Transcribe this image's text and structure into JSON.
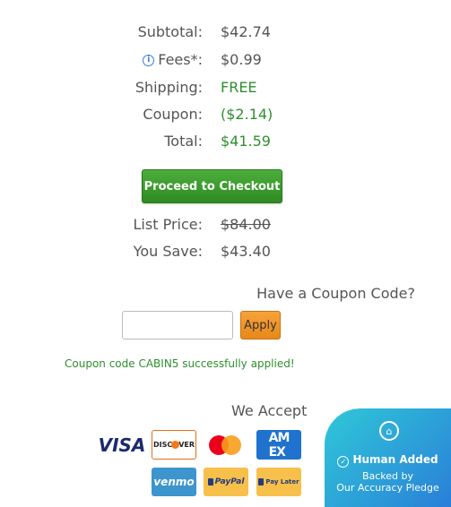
{
  "summary": {
    "subtotal": {
      "label": "Subtotal:",
      "value": "$42.74"
    },
    "fees": {
      "label": "Fees*:",
      "value": "$0.99",
      "icon": "info-icon"
    },
    "shipping": {
      "label": "Shipping:",
      "value": "FREE"
    },
    "coupon": {
      "label": "Coupon:",
      "value": "($2.14)"
    },
    "total": {
      "label": "Total:",
      "value": "$41.59"
    }
  },
  "checkout": {
    "button_label": "Proceed to Checkout"
  },
  "savings": {
    "list_price": {
      "label": "List Price:",
      "value": "$84.00"
    },
    "you_save": {
      "label": "You Save:",
      "value": "$43.40"
    }
  },
  "coupon_code": {
    "title": "Have a Coupon Code?",
    "input_value": "",
    "input_placeholder": "",
    "apply_label": "Apply",
    "success_message": "Coupon code CABIN5 successfully applied!"
  },
  "payments": {
    "title": "We Accept",
    "methods": [
      "VISA",
      "DISCOVER",
      "Mastercard",
      "AMEX",
      "venmo",
      "PayPal",
      "Pay Later"
    ]
  },
  "badge": {
    "title": "Human Added",
    "line1": "Backed by",
    "line2": "Our Accuracy Pledge"
  },
  "colors": {
    "green_text": "#2f8f2f",
    "checkout_green": "#3a9c2e",
    "apply_orange": "#f0952a",
    "badge_gradient_start": "#2fc8d8",
    "badge_gradient_end": "#2a7fd8"
  }
}
